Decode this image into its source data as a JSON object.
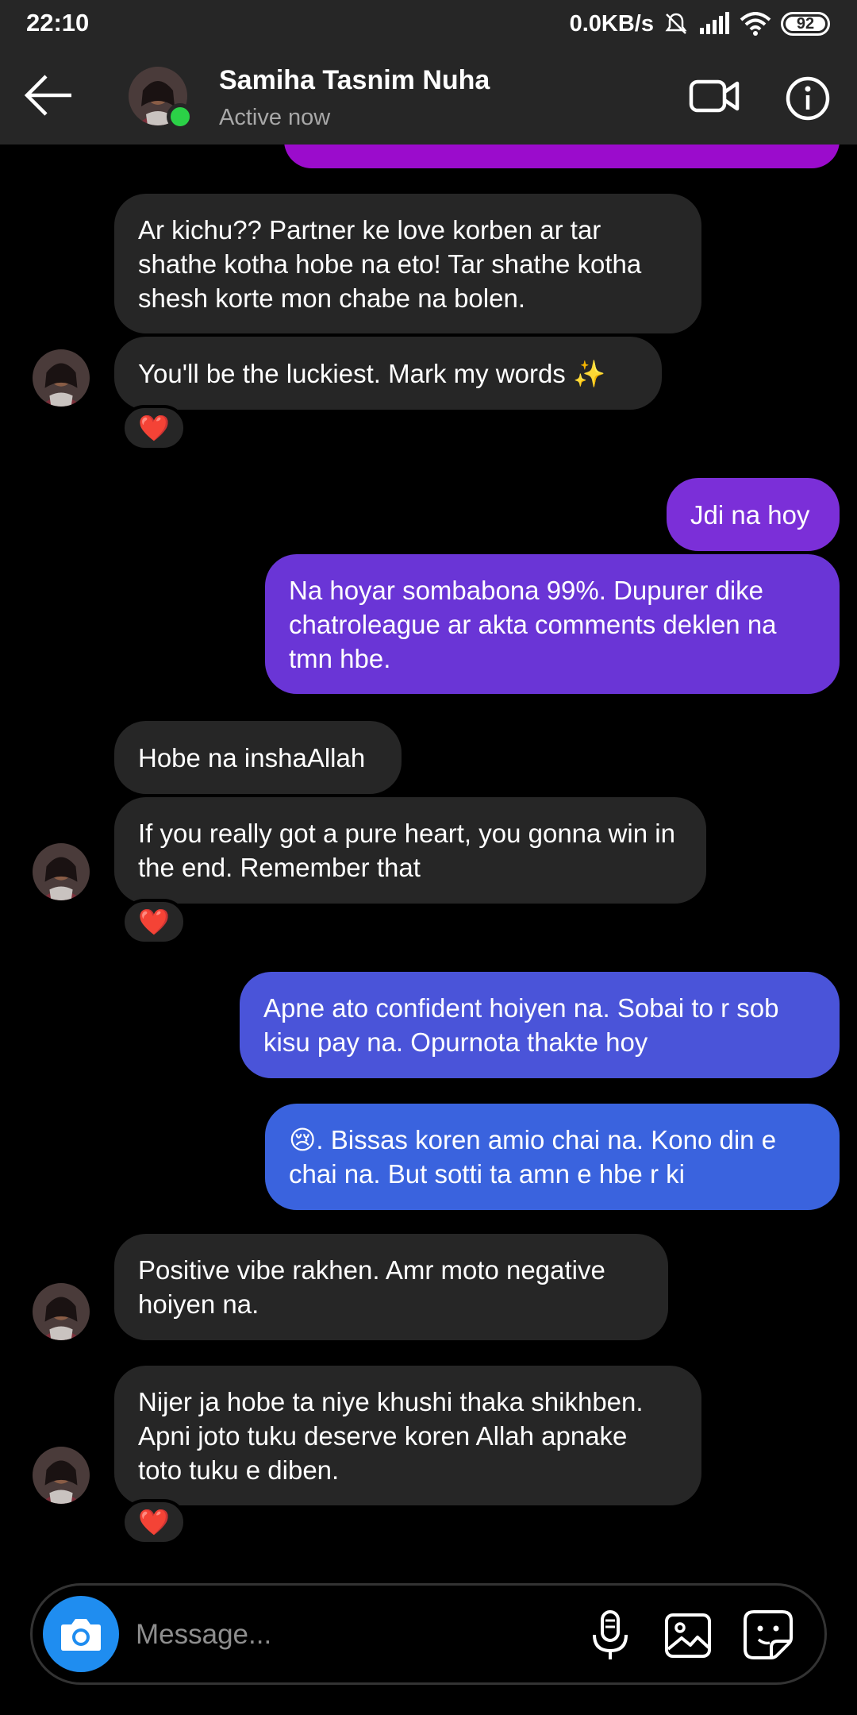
{
  "status_bar": {
    "time": "22:10",
    "network_speed": "0.0KB/s",
    "battery": "92"
  },
  "header": {
    "name": "Samiha Tasnim Nuha",
    "status": "Active now"
  },
  "messages": {
    "m1": "Ar kichu?? Partner ke love korben ar tar shathe kotha hobe na eto! Tar shathe kotha shesh korte mon chabe na bolen.",
    "m2": "You'll be the luckiest. Mark my words ✨",
    "m3": "Jdi na hoy",
    "m4": "Na hoyar sombabona 99%. Dupurer dike chatroleague ar akta comments deklen na tmn hbe.",
    "m5": "Hobe na inshaAllah",
    "m6": "If you really got a pure heart, you gonna win in the end. Remember that",
    "m7": "Apne ato confident hoiyen na. Sobai to r sob kisu pay na. Opurnota thakte hoy",
    "m8": "😢. Bissas koren amio chai na. Kono din e chai na. But sotti ta amn e hbe r ki",
    "m9": "Positive vibe rakhen. Amr moto negative hoiyen na.",
    "m10": "Nijer ja hobe ta niye khushi thaka shikhben. Apni joto tuku deserve koren Allah apnake toto tuku e diben."
  },
  "reaction_emoji": "❤️",
  "composer": {
    "placeholder": "Message..."
  },
  "colors": {
    "incoming_bubble": "#262626",
    "outgoing_purple": "#7b2fd8",
    "outgoing_blue": "#3a63de",
    "online_dot": "#2bd147",
    "camera_button": "#1f8df0"
  }
}
